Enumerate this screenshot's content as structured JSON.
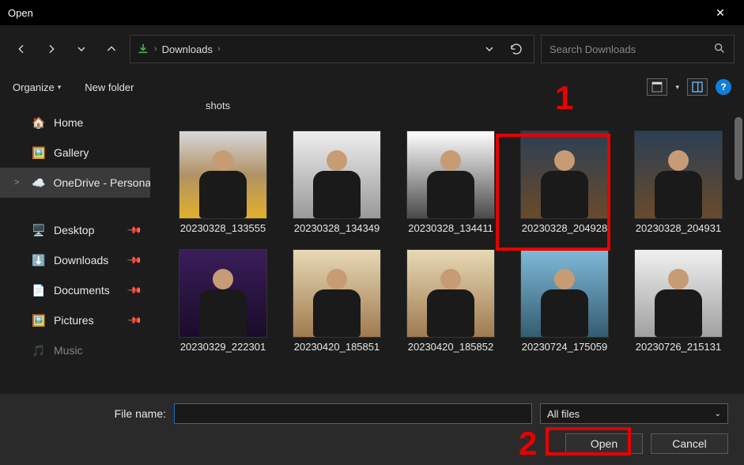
{
  "window": {
    "title": "Open"
  },
  "nav": {
    "back": "←",
    "forward": "→",
    "recent": "⌄",
    "up": "↑"
  },
  "path": {
    "location": "Downloads"
  },
  "search": {
    "placeholder": "Search Downloads"
  },
  "toolbar2": {
    "organize": "Organize",
    "newfolder": "New folder"
  },
  "sidebar": {
    "items": [
      {
        "icon": "🏠",
        "label": "Home",
        "chev": "",
        "pin": false
      },
      {
        "icon": "🖼️",
        "label": "Gallery",
        "chev": "",
        "pin": false
      },
      {
        "icon": "☁️",
        "label": "OneDrive - Personal",
        "chev": ">",
        "pin": false,
        "selected": true
      }
    ],
    "items2": [
      {
        "icon": "🖥️",
        "label": "Desktop",
        "pin": true
      },
      {
        "icon": "⬇️",
        "label": "Downloads",
        "pin": true
      },
      {
        "icon": "📄",
        "label": "Documents",
        "pin": true
      },
      {
        "icon": "🖼️",
        "label": "Pictures",
        "pin": true
      },
      {
        "icon": "🎵",
        "label": "Music",
        "pin": false
      }
    ]
  },
  "content": {
    "folder_label": "shots",
    "thumbs": [
      {
        "name": "20230328_133555"
      },
      {
        "name": "20230328_134349"
      },
      {
        "name": "20230328_134411"
      },
      {
        "name": "20230328_204928",
        "selected": true
      },
      {
        "name": "20230328_204931"
      },
      {
        "name": "20230329_222301"
      },
      {
        "name": "20230420_185851"
      },
      {
        "name": "20230420_185852"
      },
      {
        "name": "20230724_175059"
      },
      {
        "name": "20230726_215131"
      }
    ]
  },
  "footer": {
    "filename_label": "File name:",
    "filename_value": "",
    "filter": "All files",
    "open": "Open",
    "cancel": "Cancel"
  },
  "annotations": {
    "a1": "1",
    "a2": "2"
  }
}
